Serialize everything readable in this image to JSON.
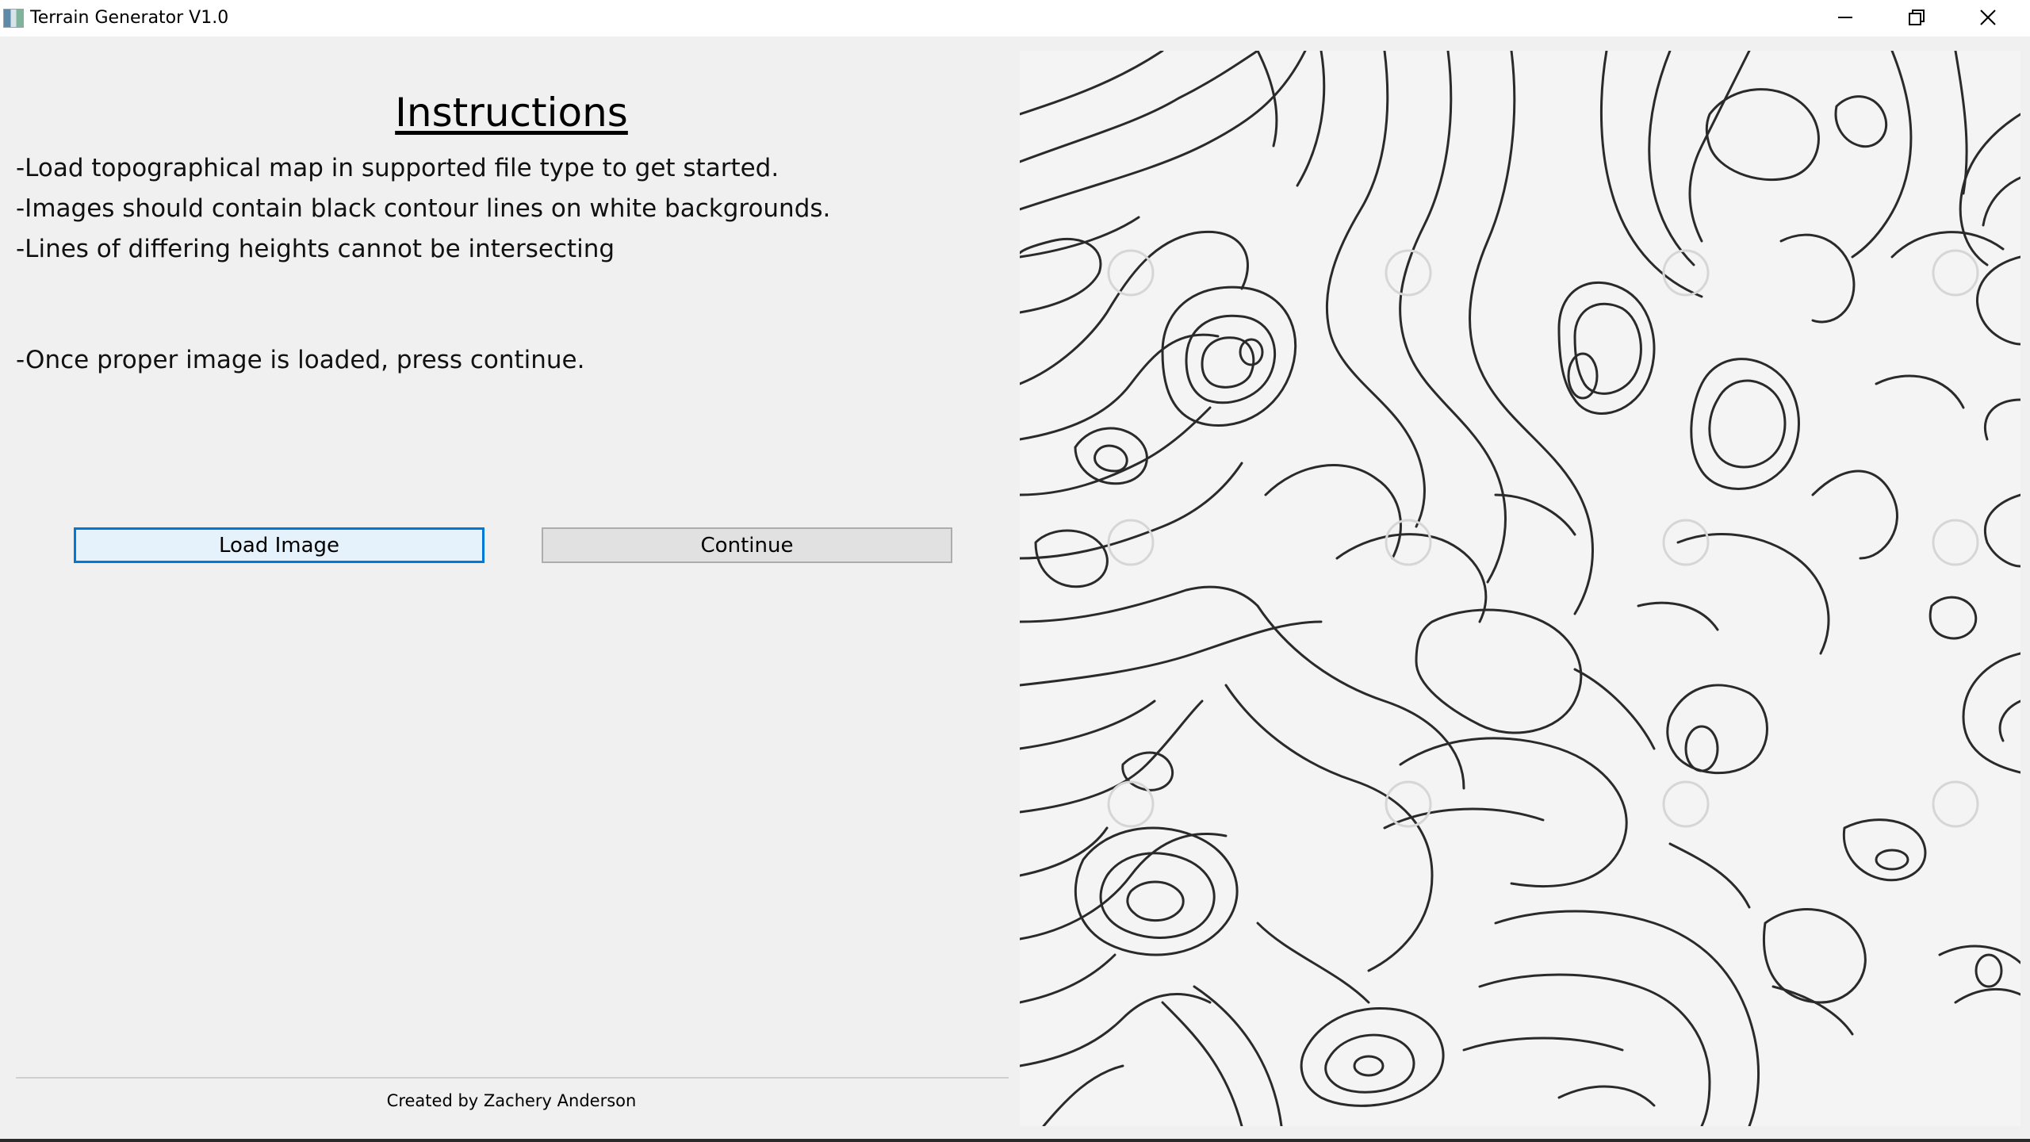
{
  "window": {
    "title": "Terrain Generator V1.0",
    "controls": [
      "minimize",
      "restore",
      "close"
    ]
  },
  "instructions": {
    "heading": "Instructions",
    "lines": [
      "-Load topographical map in supported file type to get started.",
      "-Images should contain black contour lines on white backgrounds.",
      "-Lines of differing heights cannot be intersecting",
      "-Once proper image is loaded, press continue."
    ]
  },
  "buttons": {
    "load_label": "Load Image",
    "continue_label": "Continue"
  },
  "footer": {
    "credit": "Created by Zachery Anderson"
  },
  "preview": {
    "description_icon": "topographic-contour-map-image"
  }
}
